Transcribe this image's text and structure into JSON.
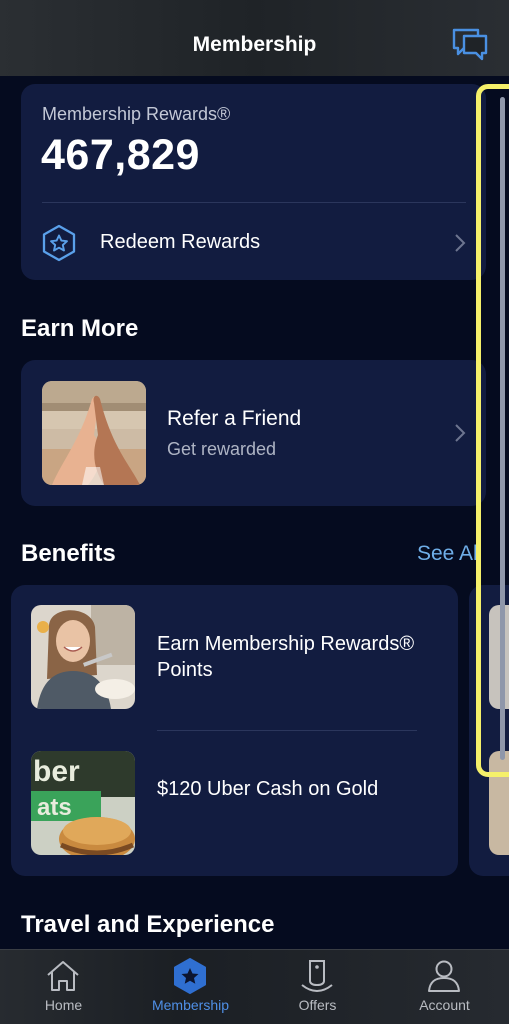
{
  "header": {
    "title": "Membership",
    "chat_icon": "chat-bubbles-icon"
  },
  "rewards": {
    "label": "Membership Rewards®",
    "points": "467,829",
    "redeem_label": "Redeem Rewards",
    "redeem_icon": "hexagon-star-icon"
  },
  "earn_more": {
    "title": "Earn More",
    "refer": {
      "title": "Refer a Friend",
      "subtitle": "Get rewarded",
      "image": "high-five-photo"
    }
  },
  "benefits": {
    "title": "Benefits",
    "see_all": "See All",
    "items": [
      {
        "label": "Earn Membership Rewards® Points",
        "image": "woman-eating-photo"
      },
      {
        "label": "$120 Uber Cash on Gold",
        "image": "uber-eats-burger-photo"
      }
    ]
  },
  "travel": {
    "title": "Travel and Experience"
  },
  "tabs": [
    {
      "label": "Home",
      "icon": "house-icon",
      "active": false
    },
    {
      "label": "Membership",
      "icon": "hexagon-star-icon",
      "active": true
    },
    {
      "label": "Offers",
      "icon": "tag-icon",
      "active": false
    },
    {
      "label": "Account",
      "icon": "person-icon",
      "active": false
    }
  ],
  "colors": {
    "background": "#050b1f",
    "card": "#121c40",
    "accent": "#4f8fe6",
    "link": "#6faee8",
    "highlight": "#f5f06a"
  }
}
